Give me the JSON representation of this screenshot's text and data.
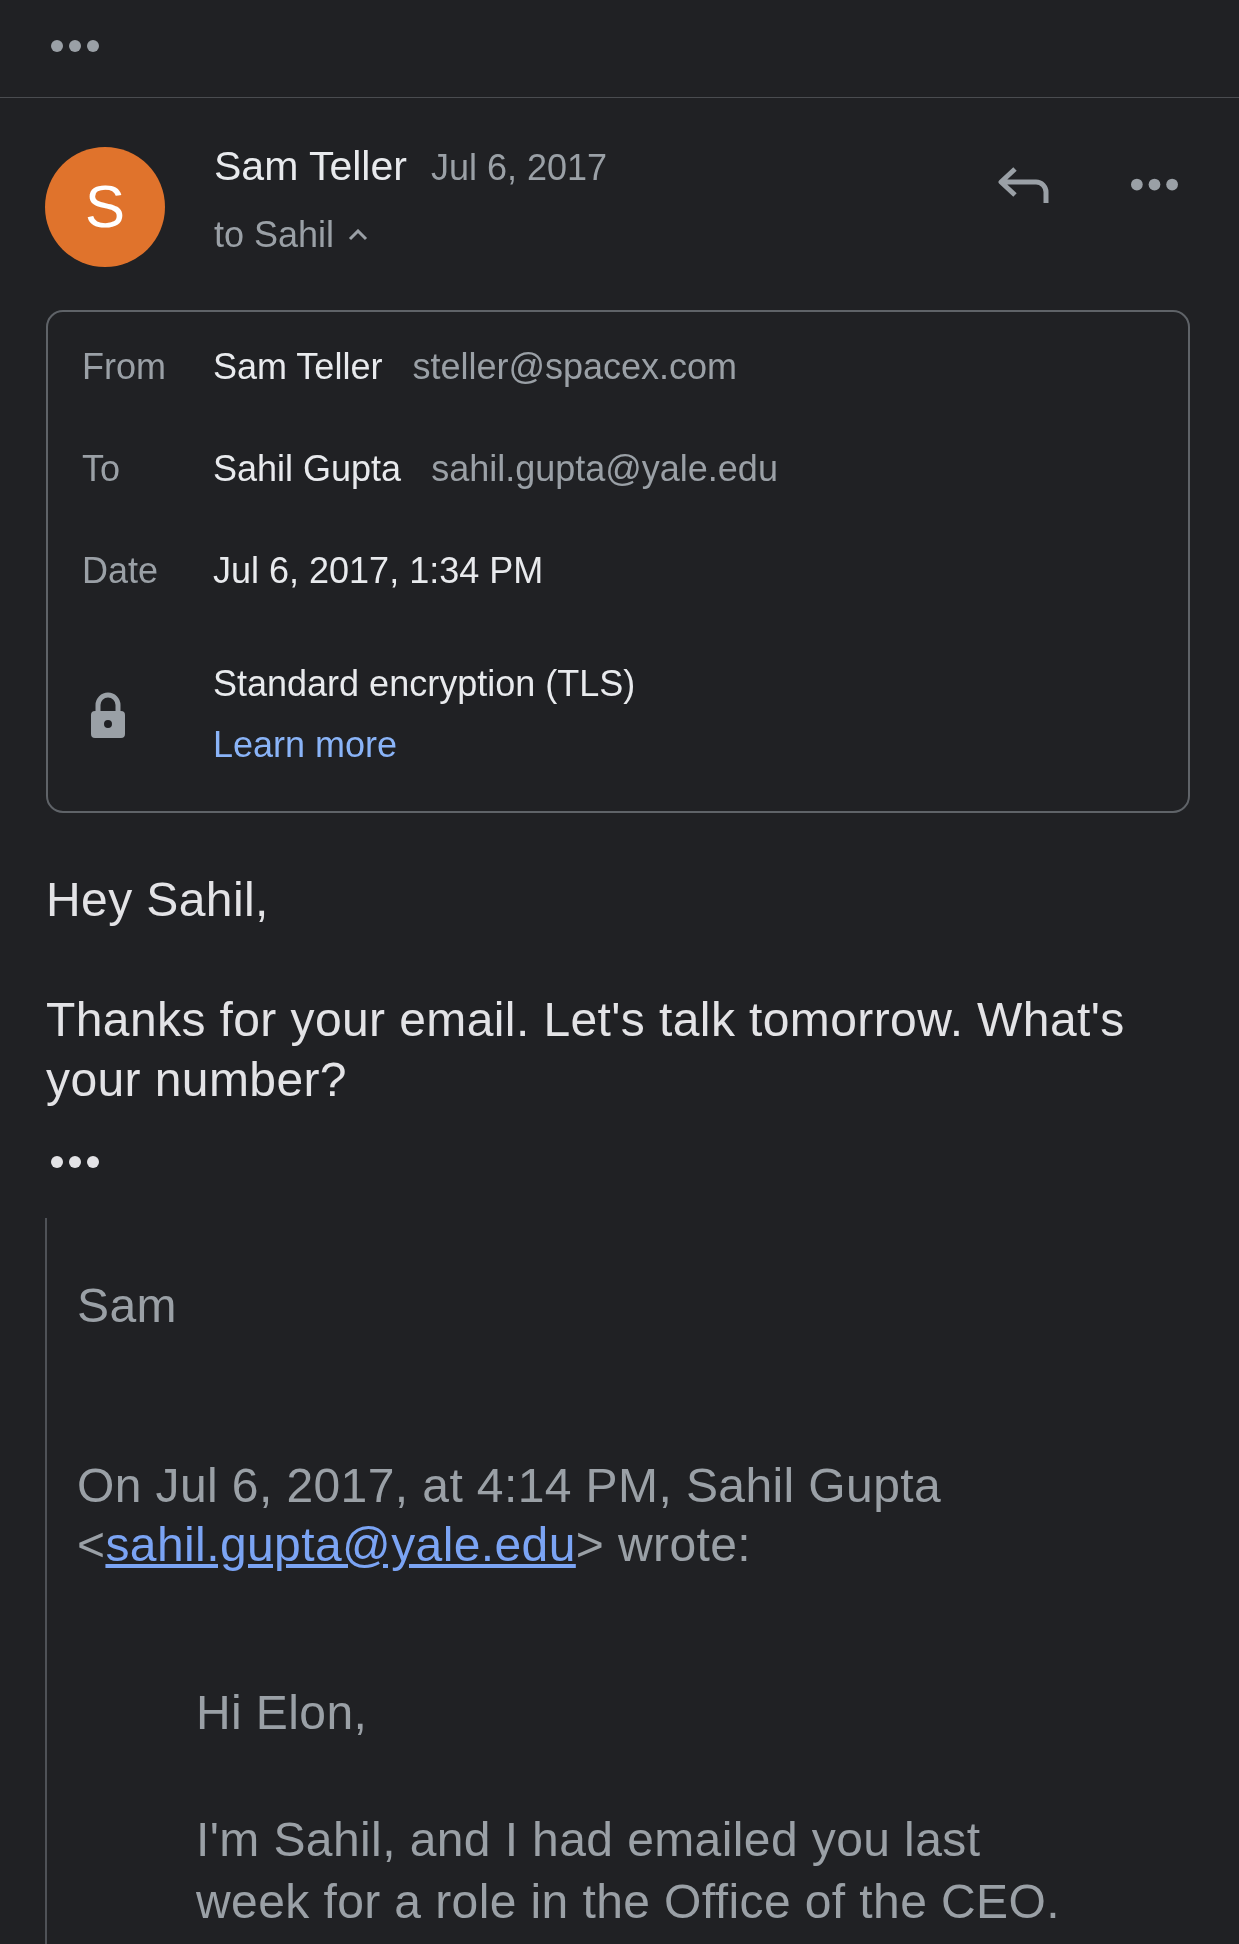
{
  "message": {
    "avatar_initial": "S",
    "sender": "Sam Teller",
    "date": "Jul 6, 2017",
    "recipients": "to Sahil",
    "details_expanded": true
  },
  "details": {
    "rows": [
      {
        "label": "From",
        "name": "Sam Teller",
        "email": "steller@spacex.com"
      },
      {
        "label": "To",
        "name": "Sahil Gupta",
        "email": "sahil.gupta@yale.edu"
      },
      {
        "label": "Date",
        "name": "Jul 6, 2017, 1:34 PM"
      }
    ],
    "security": {
      "text": "Standard encryption (TLS)",
      "link": "Learn more"
    }
  },
  "body": {
    "greeting": "Hey Sahil,",
    "paragraphs": [
      "Thanks for your email. Let's talk tomorrow. What's your number?"
    ]
  },
  "quote": {
    "signature": "Sam",
    "attribution": {
      "before": "On Jul 6, 2017, at 4:14 PM, Sahil Gupta <",
      "link": "sahil.gupta@yale.edu",
      "after": "> wrote:"
    },
    "nested": {
      "greeting": "Hi Elon,",
      "paragraphs": [
        "I'm Sahil, and I had emailed you last week for a role in the Office of the CEO."
      ]
    }
  }
}
